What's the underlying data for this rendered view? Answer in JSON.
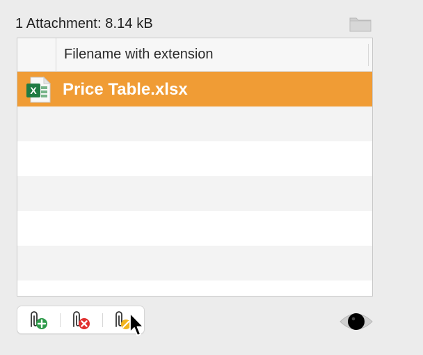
{
  "attachments": {
    "summary_label": "1 Attachment: 8.14 kB",
    "column_header": "Filename with extension",
    "files": [
      {
        "name": "Price Table.xlsx",
        "icon": "excel-file-icon"
      }
    ]
  },
  "toolbar": {
    "add_icon": "add-attachment-icon",
    "remove_icon": "remove-attachment-icon",
    "edit_icon": "edit-attachment-icon"
  },
  "actions": {
    "folder_icon": "folder-icon",
    "quicklook_icon": "eye-icon"
  },
  "colors": {
    "selection": "#f09c35",
    "add": "#2e9a4a",
    "remove": "#e0302f",
    "edit": "#f2b51e"
  }
}
